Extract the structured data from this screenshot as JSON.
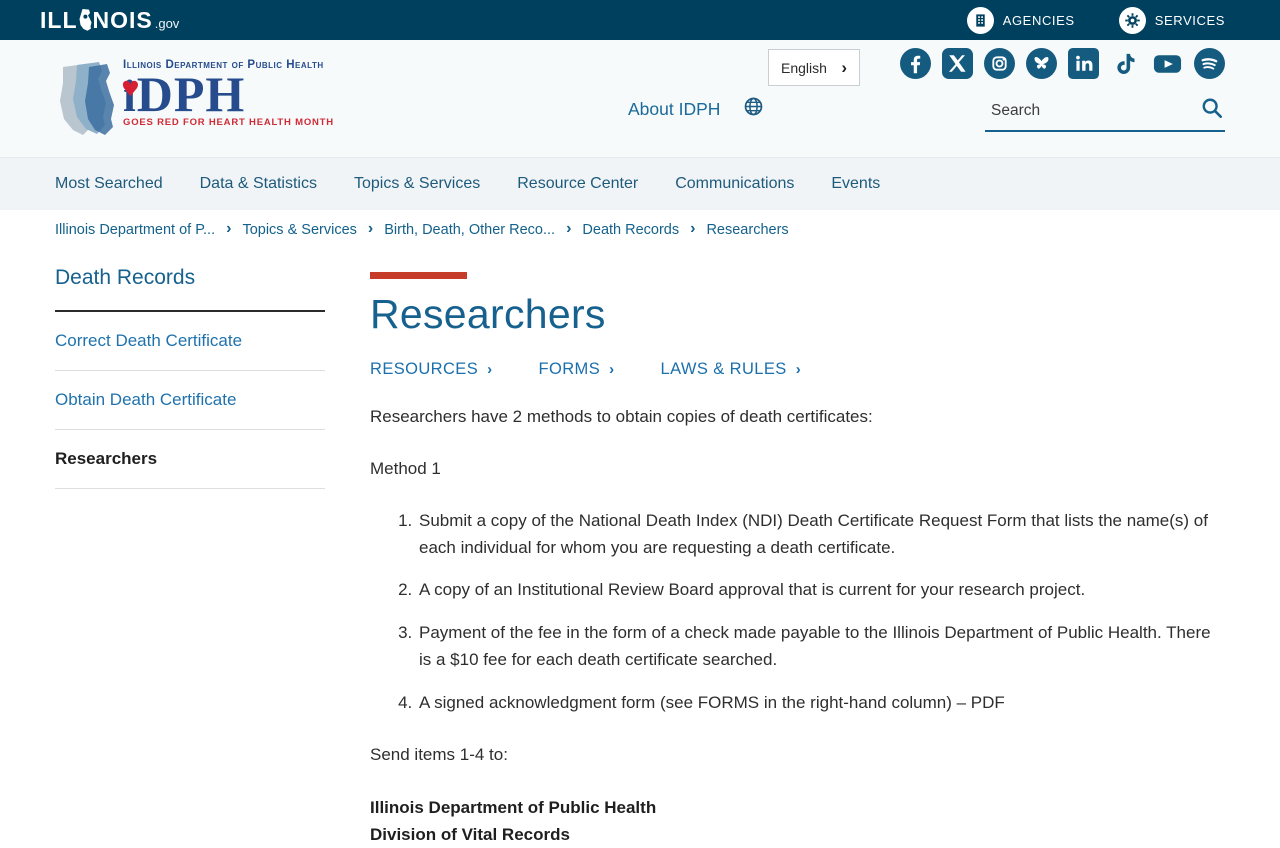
{
  "colors": {
    "topbar_bg": "#00405f",
    "header_bg": "#f7fafb",
    "nav_bg": "#f1f4f6",
    "link_blue": "#1a70ad",
    "heading_blue": "#17618e",
    "accent_red": "#c63c28",
    "logo_navy": "#264c8d",
    "logo_red": "#cf2b36",
    "social_icon_blue": "#155b80"
  },
  "icons": {
    "chevron": "›",
    "heart": "♥"
  },
  "topbar": {
    "logo": {
      "pre": "ILL",
      "post": "NOIS",
      "tld": ".gov"
    },
    "links": [
      {
        "label": "AGENCIES",
        "icon": "building-icon"
      },
      {
        "label": "SERVICES",
        "icon": "gears-icon"
      }
    ]
  },
  "header": {
    "dept_logo": {
      "line1": "Illinois Department of Public Health",
      "acronym_i": "i",
      "acronym_rest": "DPH",
      "tagline": "GOES RED FOR HEART HEALTH MONTH"
    },
    "about_label": "About IDPH",
    "language": {
      "value": "English"
    },
    "social": [
      "facebook",
      "x-twitter",
      "instagram",
      "bluesky",
      "linkedin",
      "tiktok",
      "youtube",
      "spotify"
    ],
    "search": {
      "placeholder": "Search"
    }
  },
  "nav": {
    "items": [
      "Most Searched",
      "Data & Statistics",
      "Topics & Services",
      "Resource Center",
      "Communications",
      "Events"
    ]
  },
  "breadcrumb": {
    "items": [
      "Illinois Department of P...",
      "Topics & Services",
      "Birth, Death, Other Reco...",
      "Death Records",
      "Researchers"
    ]
  },
  "sidebar": {
    "title": "Death Records",
    "items": [
      {
        "label": "Correct Death Certificate",
        "active": false
      },
      {
        "label": "Obtain Death Certificate",
        "active": false
      },
      {
        "label": "Researchers",
        "active": true
      }
    ]
  },
  "main": {
    "title": "Researchers",
    "tabs": [
      {
        "label": "RESOURCES"
      },
      {
        "label": "FORMS"
      },
      {
        "label": "LAWS & RULES"
      }
    ],
    "intro": "Researchers have 2 methods to obtain copies of death certificates:",
    "method_label": "Method 1",
    "list": [
      "Submit a copy of the National Death Index (NDI) Death Certificate Request Form that lists the name(s) of each individual for whom you are requesting a death certificate.",
      "A copy of an Institutional Review Board approval that is current for your research project.",
      "Payment of the fee in the form of a check made payable to the Illinois Department of Public Health. There is a $10 fee for each death certificate searched.",
      "A signed acknowledgment form (see FORMS in the right-hand column) – PDF"
    ],
    "send_to": "Send items 1-4 to:",
    "address": [
      "Illinois Department of Public Health",
      "Division of Vital Records"
    ]
  }
}
